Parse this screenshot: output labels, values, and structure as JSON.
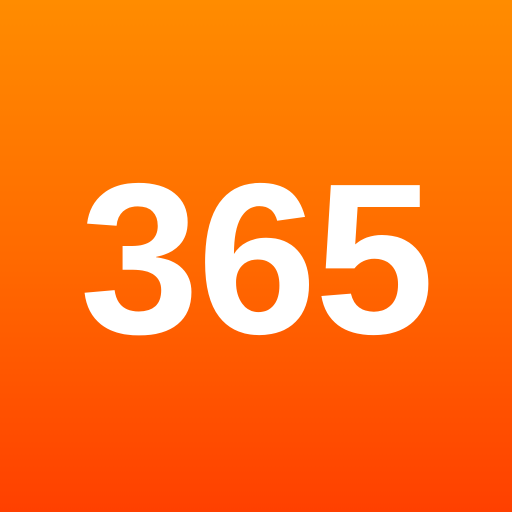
{
  "icon": {
    "number_text": "365",
    "colors": {
      "gradient_top": "#FF8C00",
      "gradient_mid": "#FF6A00",
      "gradient_bottom": "#FF4000",
      "text": "#FFFFFF"
    }
  }
}
